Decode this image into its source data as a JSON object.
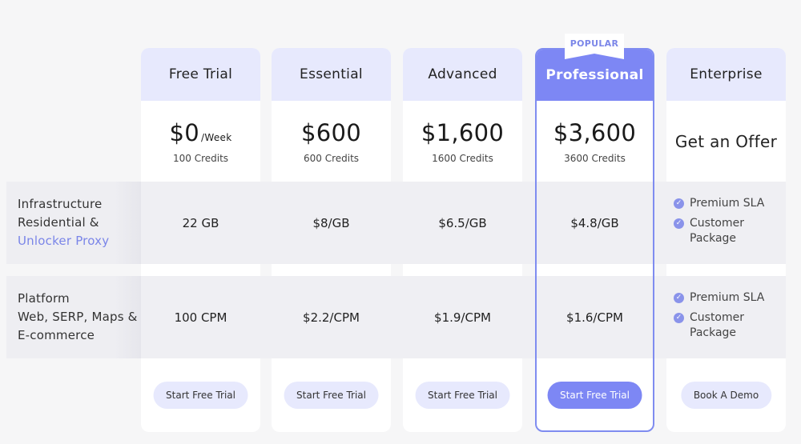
{
  "popular_badge": "POPULAR",
  "rows": {
    "infrastructure": {
      "line1": "Infrastructure",
      "line2": "Residential &",
      "line3": "Unlocker Proxy"
    },
    "platform": {
      "line1": "Platform",
      "line2": "Web, SERP, Maps &",
      "line3": "E-commerce"
    }
  },
  "plans": [
    {
      "name": "Free Trial",
      "price": "$0",
      "period": "/Week",
      "credits": "100 Credits",
      "infra": "22 GB",
      "platform": "100 CPM",
      "button": "Start Free Trial"
    },
    {
      "name": "Essential",
      "price": "$600",
      "credits": "600 Credits",
      "infra": "$8/GB",
      "platform": "$2.2/CPM",
      "button": "Start Free Trial"
    },
    {
      "name": "Advanced",
      "price": "$1,600",
      "credits": "1600 Credits",
      "infra": "$6.5/GB",
      "platform": "$1.9/CPM",
      "button": "Start Free Trial"
    },
    {
      "name": "Professional",
      "price": "$3,600",
      "credits": "3600 Credits",
      "infra": "$4.8/GB",
      "platform": "$1.6/CPM",
      "button": "Start Free Trial"
    },
    {
      "name": "Enterprise",
      "offer": "Get an Offer",
      "infra_features": [
        "Premium SLA",
        "Customer Package"
      ],
      "platform_features": [
        "Premium SLA",
        "Customer Package"
      ],
      "button": "Book A Demo"
    }
  ],
  "icons": {
    "feature": "check-circle-icon"
  },
  "colors": {
    "accent": "#7d87f4",
    "header_bg": "#e7e9fd",
    "row_bg": "#efeff3"
  }
}
